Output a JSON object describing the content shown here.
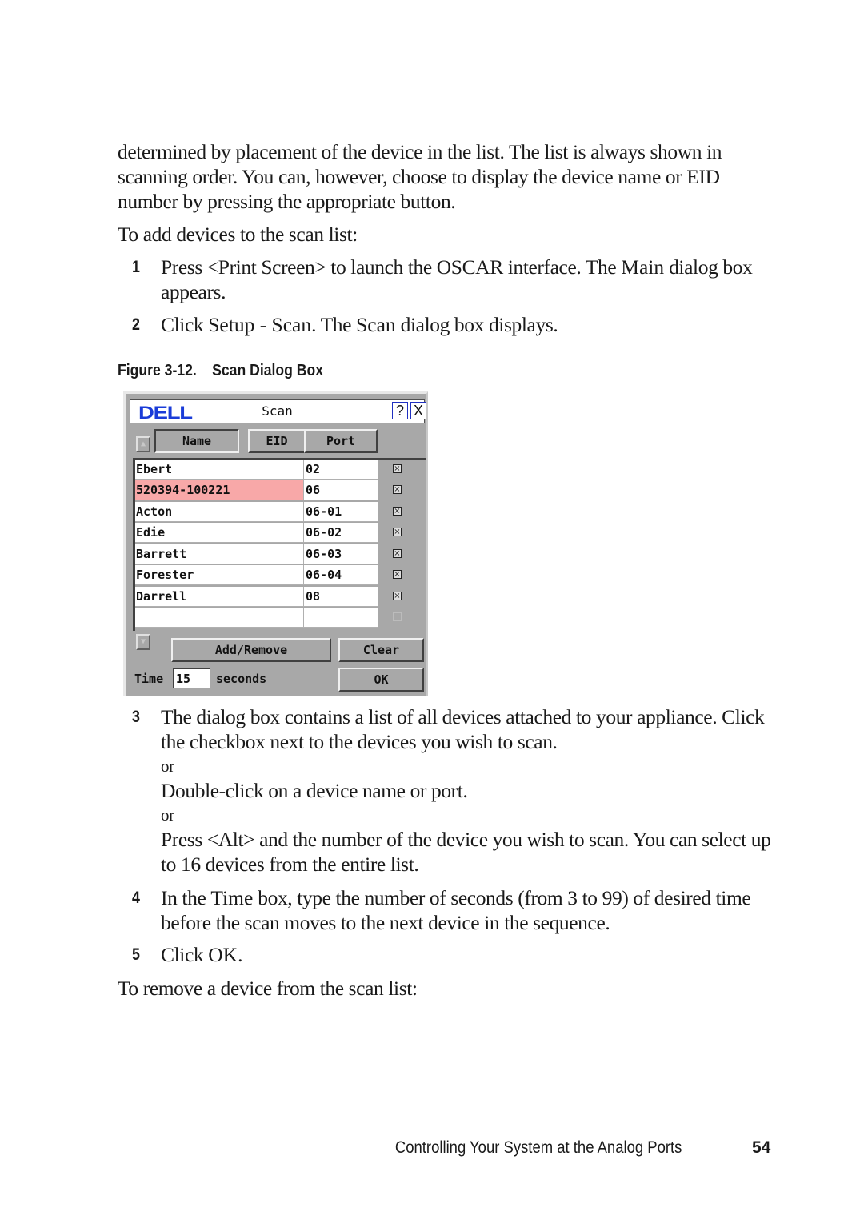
{
  "intro_paragraph": "determined by placement of the device in the list. The list is always shown in scanning order. You can, however, choose to display the device name or EID number by pressing the appropriate button.",
  "add_heading": "To add devices to the scan list:",
  "steps": [
    {
      "num": "1",
      "pre": "Press <Print Screen> to launch the OSCAR interface. The ",
      "ui": "Main",
      "post": " dialog box appears."
    },
    {
      "num": "2",
      "pre": "Click ",
      "ui": "Setup - Scan",
      "mid": ". The ",
      "ui2": "Scan",
      "post": " dialog box displays."
    },
    {
      "num": "3",
      "line1": "The dialog box contains a list of all devices attached to your appliance. Click the checkbox next to the devices you wish to scan.",
      "or1": "or",
      "line2": "Double-click on a device name or port.",
      "or2": "or",
      "line3": "Press <Alt> and the number of the device you wish to scan. You can select up to 16 devices from the entire list."
    },
    {
      "num": "4",
      "pre": "In the ",
      "ui": "Time",
      "post": " box, type the number of seconds (from 3 to 99) of desired time before the scan moves to the next device in the sequence."
    },
    {
      "num": "5",
      "pre": "Click ",
      "ui": "OK",
      "post": "."
    }
  ],
  "remove_heading": "To remove a device from the scan list:",
  "figure": {
    "label": "Figure 3-12.",
    "title": "Scan Dialog Box"
  },
  "dialog": {
    "logo": "DELL",
    "title": "Scan",
    "help_icon": "?",
    "close_icon": "X",
    "scroll_up_icon": "▲",
    "scroll_down_icon": "▼",
    "sort_buttons": {
      "name": "Name",
      "eid": "EID",
      "port": "Port"
    },
    "rows": [
      {
        "name": "Ebert",
        "port": "02",
        "checked": true,
        "selected": false
      },
      {
        "name": "520394-100221",
        "port": "06",
        "checked": true,
        "selected": true
      },
      {
        "name": "Acton",
        "port": "06-01",
        "checked": true,
        "selected": false
      },
      {
        "name": "Edie",
        "port": "06-02",
        "checked": true,
        "selected": false
      },
      {
        "name": "Barrett",
        "port": "06-03",
        "checked": true,
        "selected": false
      },
      {
        "name": "Forester",
        "port": "06-04",
        "checked": true,
        "selected": false
      },
      {
        "name": "Darrell",
        "port": "08",
        "checked": true,
        "selected": false
      },
      {
        "name": "",
        "port": "",
        "checked": false,
        "selected": false
      }
    ],
    "add_remove_label": "Add/Remove",
    "clear_label": "Clear",
    "time_label": "Time",
    "time_value": "15",
    "seconds_label": "seconds",
    "ok_label": "OK",
    "selected_color": "#f8a8a8",
    "logo_color": "#1a3cd8"
  },
  "footer": {
    "title": "Controlling Your System at the Analog Ports",
    "page": "54"
  }
}
